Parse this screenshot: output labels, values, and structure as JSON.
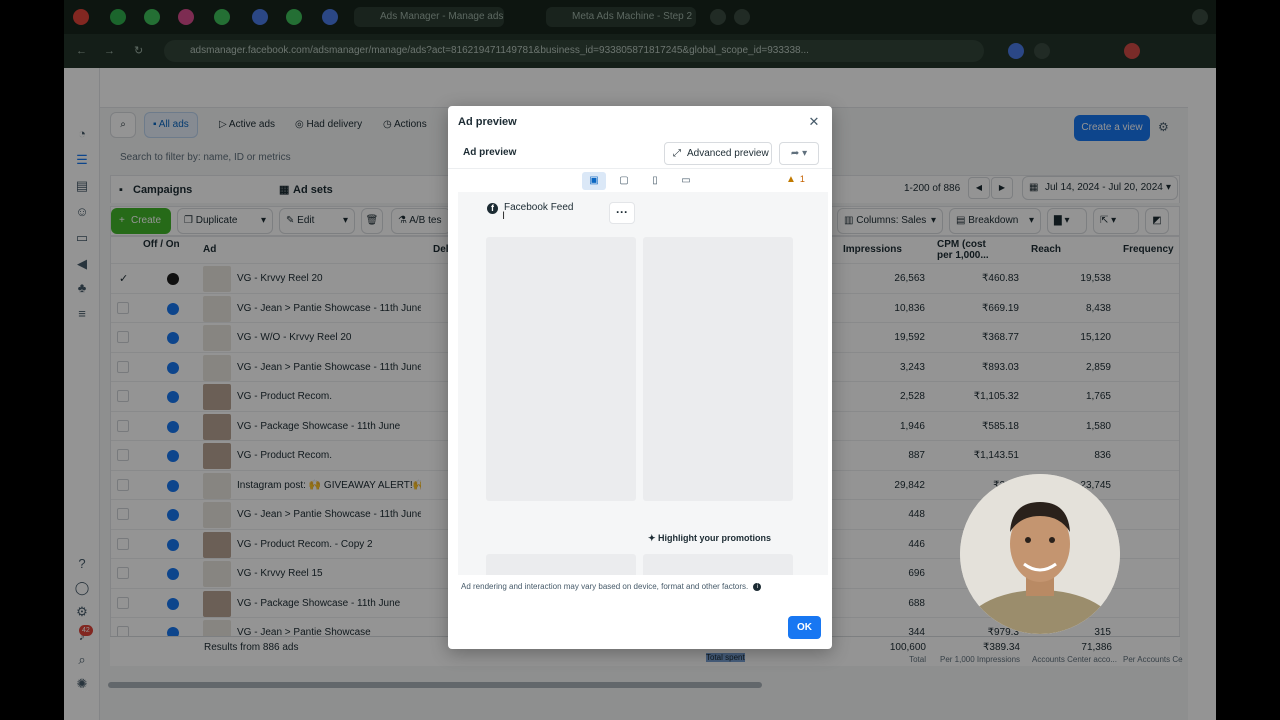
{
  "browser": {
    "tabs": [
      {
        "label": "Ads Manager - Manage ads"
      },
      {
        "label": "Meta Ads Machine - Step 2"
      }
    ],
    "url": "adsmanager.facebook.com/adsmanager/manage/ads?act=816219471149781&business_id=933805871817245&global_scope_id=933338..."
  },
  "toolbar": {
    "all_ads": "All ads",
    "active_ads": "Active ads",
    "had_delivery": "Had delivery",
    "actions": "Actions",
    "create_view": "Create a view"
  },
  "filter_placeholder": "Search to filter by: name, ID or metrics",
  "level_tabs": {
    "campaigns": "Campaigns",
    "ad_sets": "Ad sets"
  },
  "pager": {
    "range": "1-200 of 886"
  },
  "date_range": "Jul 14, 2024 - Jul 20, 2024",
  "actions_bar": {
    "create": "Create",
    "duplicate": "Duplicate",
    "edit": "Edit",
    "ab_test": "A/B tes",
    "columns": "Columns: Sales",
    "breakdown": "Breakdown"
  },
  "table": {
    "headers": {
      "off_on": "Off / On",
      "ad": "Ad",
      "delivery": "Del",
      "impressions": "Impressions",
      "cpm": "CPM (cost per 1,000...",
      "reach": "Reach",
      "frequency": "Frequency"
    },
    "rows": [
      {
        "name": "VG - Krvvy Reel 20",
        "impressions": "26,563",
        "cpm": "₹460.83",
        "reach": "19,538"
      },
      {
        "name": "VG - Jean > Pantie Showcase - 11th June - 1",
        "impressions": "10,836",
        "cpm": "₹669.19",
        "reach": "8,438"
      },
      {
        "name": "VG - W/O - Krvvy Reel 20",
        "impressions": "19,592",
        "cpm": "₹368.77",
        "reach": "15,120"
      },
      {
        "name": "VG - Jean > Pantie Showcase - 11th June - ...",
        "impressions": "3,243",
        "cpm": "₹893.03",
        "reach": "2,859"
      },
      {
        "name": "VG - Product Recom.",
        "impressions": "2,528",
        "cpm": "₹1,105.32",
        "reach": "1,765"
      },
      {
        "name": "VG - Package Showcase - 11th June",
        "impressions": "1,946",
        "cpm": "₹585.18",
        "reach": "1,580"
      },
      {
        "name": "VG - Product Recom.",
        "impressions": "887",
        "cpm": "₹1,143.51",
        "reach": "836"
      },
      {
        "name": "Instagram post: 🙌 GIVEAWAY ALERT!🙌 ...",
        "impressions": "29,842",
        "cpm": "₹29.1",
        "reach": "23,745"
      },
      {
        "name": "VG - Jean > Pantie Showcase - 11th June - ...",
        "impressions": "448",
        "cpm": "",
        "reach": ""
      },
      {
        "name": "VG - Product Recom. - Copy 2",
        "impressions": "446",
        "cpm": "",
        "reach": ""
      },
      {
        "name": "VG - Krvvy Reel 15",
        "impressions": "696",
        "cpm": "",
        "reach": ""
      },
      {
        "name": "VG - Package Showcase - 11th June",
        "impressions": "688",
        "cpm": "",
        "reach": ""
      },
      {
        "name": "VG - Jean > Pantie Showcase",
        "impressions": "344",
        "cpm": "₹979.3",
        "reach": "315"
      }
    ],
    "totals": {
      "results": "Results from 886 ads",
      "total_spent": "Total spent",
      "impressions": "100,600",
      "impressions_sub": "Total",
      "cpm": "₹389.34",
      "cpm_sub": "Per 1,000 Impressions",
      "reach": "71,386",
      "reach_sub": "Accounts Center acco...",
      "frequency_sub": "Per Accounts Ce"
    }
  },
  "left_nav": {
    "notification_badge": "42"
  },
  "modal": {
    "title": "Ad preview",
    "subtitle": "Ad preview",
    "advanced_preview": "Advanced preview",
    "warning_count": "1",
    "placement_label": "Facebook Feed",
    "highlight_text": "Highlight your promotions",
    "disclaimer": "Ad rendering and interaction may vary based on device, format and other factors.",
    "ok": "OK"
  },
  "colors": {
    "primary": "#1877f2",
    "create_green": "#42b72a",
    "warning": "#c17a00"
  }
}
